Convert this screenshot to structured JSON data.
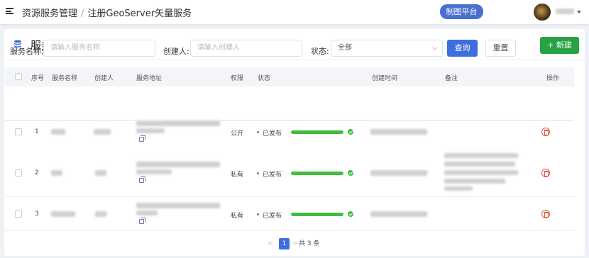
{
  "header": {
    "breadcrumb": [
      "资源服务管理",
      "注册GeoServer矢量服务"
    ],
    "separator": "/",
    "platform_button": "制图平台"
  },
  "card": {
    "title": "服务列表",
    "new_button": "+ 新建"
  },
  "filters": {
    "name_label": "服务名称:",
    "name_placeholder": "请输入服务名称",
    "creator_label": "创建人:",
    "creator_placeholder": "请输入创建人",
    "status_label": "状态:",
    "status_value": "全部",
    "query_button": "查询",
    "reset_button": "重置"
  },
  "table": {
    "columns": [
      "序号",
      "服务名称",
      "创建人",
      "服务地址",
      "权限",
      "状态",
      "创建时间",
      "备注",
      "操作"
    ],
    "rows": [
      {
        "index": "1",
        "permission": "公开",
        "status": "已发布",
        "progress": 1.0
      },
      {
        "index": "2",
        "permission": "私有",
        "status": "已发布",
        "progress": 1.0
      },
      {
        "index": "3",
        "permission": "私有",
        "status": "已发布",
        "progress": 1.0
      }
    ]
  },
  "pagination": {
    "prev": "<",
    "current": "1",
    "next": ">",
    "total": "共 3 条"
  },
  "colors": {
    "primary": "#3e6ddd",
    "success": "#27a245",
    "progress": "#3fbe3b",
    "danger": "#e4583a"
  }
}
